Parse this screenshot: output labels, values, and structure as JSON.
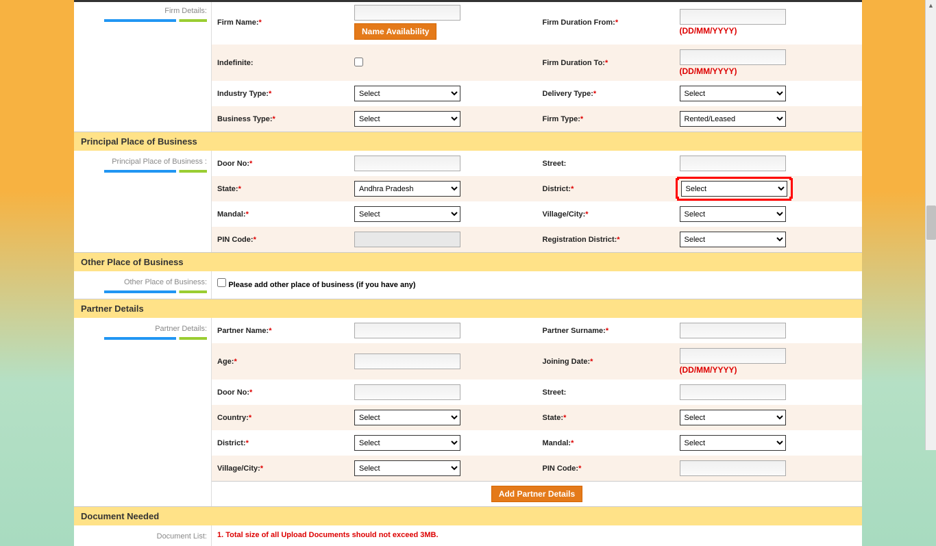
{
  "firm_details": {
    "side_label": "Firm Details:",
    "firm_name": {
      "label": "Firm Name:",
      "btn": "Name Availability"
    },
    "firm_duration_from": {
      "label": "Firm Duration From:",
      "hint": "(DD/MM/YYYY)"
    },
    "indefinite": {
      "label": "Indefinite:"
    },
    "firm_duration_to": {
      "label": "Firm Duration To:",
      "hint": "(DD/MM/YYYY)"
    },
    "industry_type": {
      "label": "Industry Type:",
      "value": "Select"
    },
    "delivery_type": {
      "label": "Delivery Type:",
      "value": "Select"
    },
    "business_type": {
      "label": "Business Type:",
      "value": "Select"
    },
    "firm_type": {
      "label": "Firm Type:",
      "value": "Rented/Leased"
    }
  },
  "principal_place": {
    "header": "Principal Place of Business",
    "side_label": "Principal Place of Business :",
    "door_no": {
      "label": "Door No:"
    },
    "street": {
      "label": "Street:"
    },
    "state": {
      "label": "State:",
      "value": "Andhra Pradesh"
    },
    "district": {
      "label": "District:",
      "value": "Select"
    },
    "mandal": {
      "label": "Mandal:",
      "value": "Select"
    },
    "village_city": {
      "label": "Village/City:",
      "value": "Select"
    },
    "pin_code": {
      "label": "PIN Code:"
    },
    "registration_district": {
      "label": "Registration District:",
      "value": "Select"
    }
  },
  "other_place": {
    "header": "Other Place of Business",
    "side_label": "Other Place of Business:",
    "checkbox_label": "Please add other place of business (if you have any)"
  },
  "partner_details": {
    "header": "Partner Details",
    "side_label": "Partner Details:",
    "partner_name": {
      "label": "Partner Name:"
    },
    "partner_surname": {
      "label": "Partner Surname:"
    },
    "age": {
      "label": "Age:"
    },
    "joining_date": {
      "label": "Joining Date:",
      "hint": "(DD/MM/YYYY)"
    },
    "door_no": {
      "label": "Door No:"
    },
    "street": {
      "label": "Street:"
    },
    "country": {
      "label": "Country:",
      "value": "Select"
    },
    "state": {
      "label": "State:",
      "value": "Select"
    },
    "district": {
      "label": "District:",
      "value": "Select"
    },
    "mandal": {
      "label": "Mandal:",
      "value": "Select"
    },
    "village_city": {
      "label": "Village/City:",
      "value": "Select"
    },
    "pin_code": {
      "label": "PIN Code:"
    },
    "add_btn": "Add Partner Details"
  },
  "document_needed": {
    "header": "Document Needed",
    "side_label": "Document List:",
    "note": "1. Total size of all Upload Documents should not exceed 3MB."
  }
}
